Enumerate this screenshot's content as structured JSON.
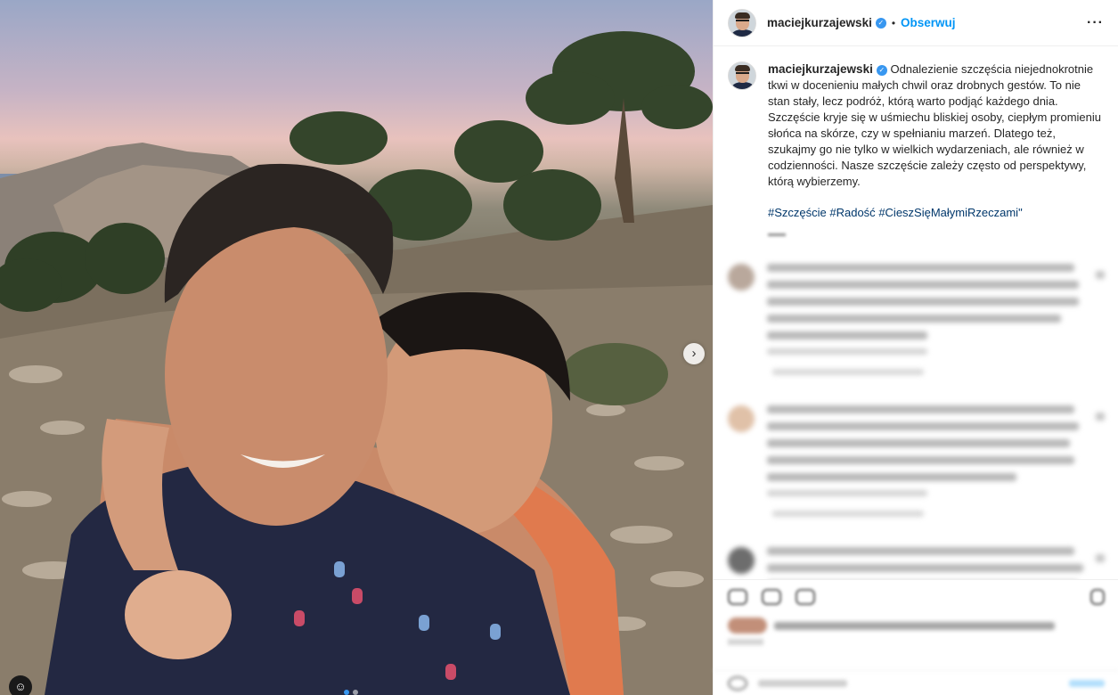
{
  "post": {
    "username": "maciejkurzajewski",
    "verified_icon": "verified-badge-icon",
    "separator": "•",
    "follow_label": "Obserwuj",
    "more_label": "···",
    "caption": "Odnalezienie szczęścia niejednokrotnie tkwi w docenieniu małych chwil oraz drobnych gestów. To nie stan stały, lecz podróż, którą warto podjąć każdego dnia. Szczęście kryje się w uśmiechu bliskiej osoby, ciepłym promieniu słońca na skórze, czy w spełnianiu marzeń. Dlatego też, szukajmy go nie tylko w wielkich wydarzeniach, ale również w codzienności. Nasze szczęście zależy często od perspektywy, którą wybierzemy.",
    "hashtags": [
      "#Szczęście",
      "#Radość",
      "#CieszSięMałymiRzeczami\""
    ],
    "next_arrow": "›",
    "tagged_icon": "user-tag-icon",
    "carousel": {
      "count": 2,
      "active": 0
    }
  },
  "colors": {
    "accent": "#0095f6",
    "verified": "#3897f0",
    "hashtag": "#00376b"
  }
}
